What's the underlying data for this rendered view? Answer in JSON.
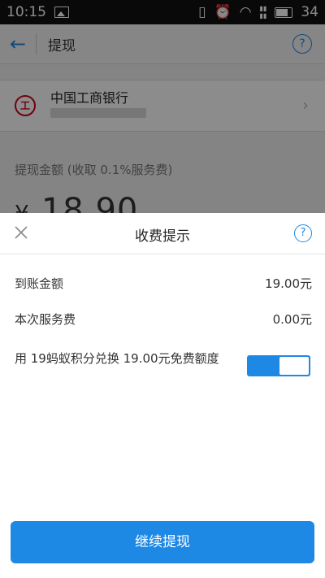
{
  "status_bar": {
    "time": "10:15",
    "battery": "34"
  },
  "header": {
    "title": "提现",
    "help": "?"
  },
  "bank": {
    "logo_text": "工",
    "name": "中国工商银行"
  },
  "amount": {
    "label": "提现金额 (收取 0.1%服务费)",
    "currency": "¥",
    "value": "18.90"
  },
  "sheet": {
    "title": "收费提示",
    "help": "?",
    "rows": [
      {
        "label": "到账金额",
        "value": "19.00元"
      },
      {
        "label": "本次服务费",
        "value": "0.00元"
      }
    ],
    "toggle_label": "用 19蚂蚁积分兑换 19.00元免费额度",
    "toggle_on": true,
    "continue_label": "继续提现"
  },
  "colors": {
    "accent": "#1e88e5",
    "bank_red": "#d0021b"
  }
}
